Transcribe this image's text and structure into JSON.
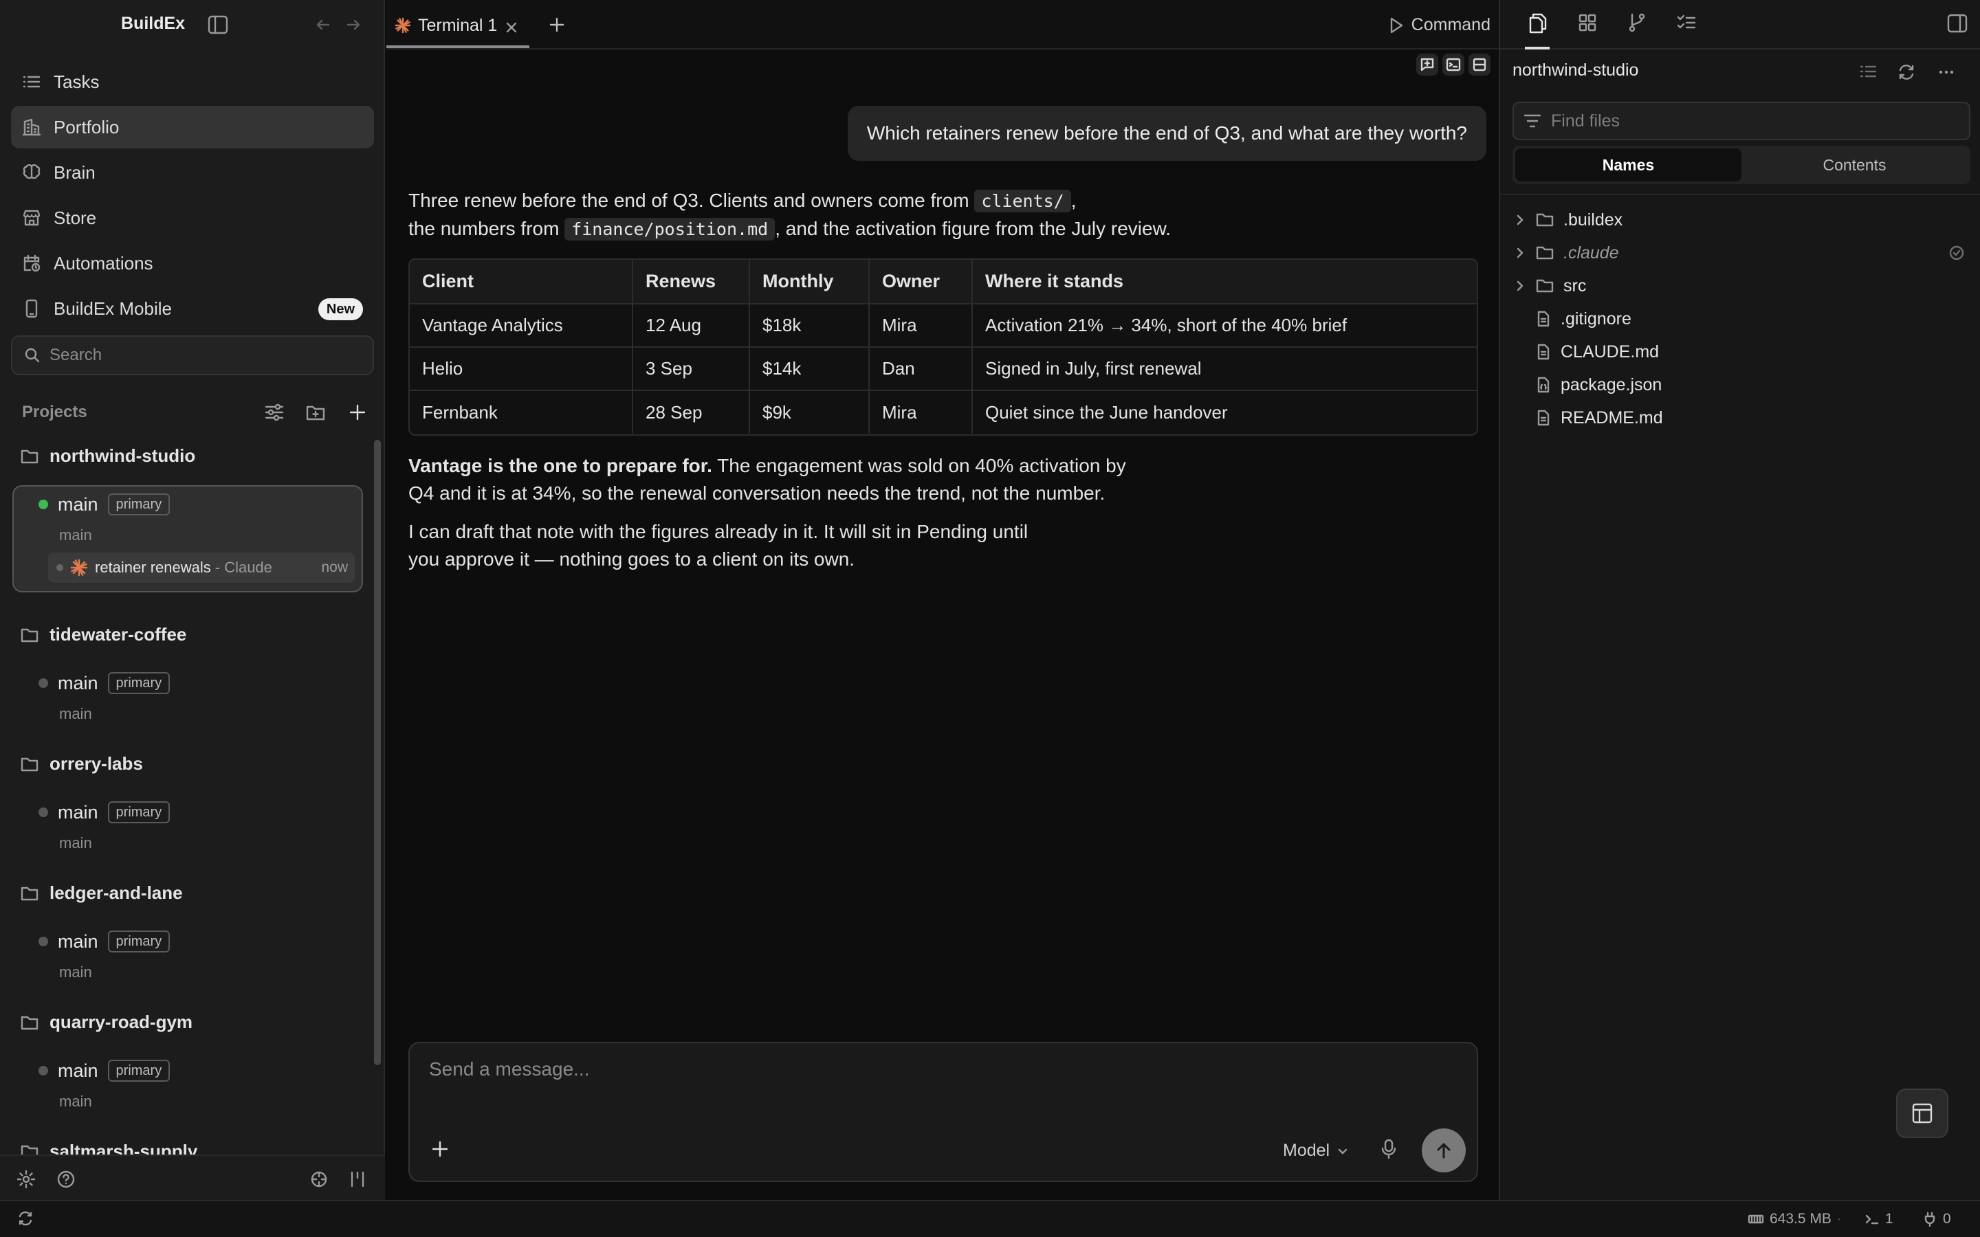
{
  "app": {
    "name": "BuildEx"
  },
  "sidebar": {
    "nav": [
      {
        "label": "Tasks",
        "icon": "list-icon"
      },
      {
        "label": "Portfolio",
        "icon": "building-icon",
        "active": true
      },
      {
        "label": "Brain",
        "icon": "brain-icon"
      },
      {
        "label": "Store",
        "icon": "store-icon"
      },
      {
        "label": "Automations",
        "icon": "calendar-clock-icon"
      },
      {
        "label": "BuildEx Mobile",
        "icon": "phone-icon",
        "badge": "New"
      }
    ],
    "search_placeholder": "Search",
    "projects_label": "Projects",
    "projects": [
      {
        "name": "northwind-studio",
        "branch": "main",
        "tag": "primary",
        "sub": "main",
        "active": true,
        "session": {
          "name": "retainer renewals",
          "agent": "- Claude",
          "time": "now"
        }
      },
      {
        "name": "tidewater-coffee",
        "branch": "main",
        "tag": "primary",
        "sub": "main"
      },
      {
        "name": "orrery-labs",
        "branch": "main",
        "tag": "primary",
        "sub": "main"
      },
      {
        "name": "ledger-and-lane",
        "branch": "main",
        "tag": "primary",
        "sub": "main"
      },
      {
        "name": "quarry-road-gym",
        "branch": "main",
        "tag": "primary",
        "sub": "main"
      },
      {
        "name": "saltmarsh-supply"
      }
    ]
  },
  "terminal": {
    "tab_label": "Terminal 1",
    "command_label": "Command",
    "user_message": "Which retainers renew before the end of Q3, and what are they worth?",
    "reply": {
      "intro_a": "Three renew before the end of Q3. Clients and owners come from ",
      "code1": "clients/",
      "intro_b": ",",
      "intro_c": "the numbers from ",
      "code2": "finance/position.md",
      "intro_d": ", and the activation figure from the July review.",
      "table": {
        "headers": [
          "Client",
          "Renews",
          "Monthly",
          "Owner",
          "Where it stands"
        ],
        "rows": [
          [
            "Vantage Analytics",
            "12 Aug",
            "$18k",
            "Mira",
            "Activation 21% → 34%, short of the 40% brief"
          ],
          [
            "Helio",
            "3 Sep",
            "$14k",
            "Dan",
            "Signed in July, first renewal"
          ],
          [
            "Fernbank",
            "28 Sep",
            "$9k",
            "Mira",
            "Quiet since the June handover"
          ]
        ]
      },
      "p2_bold": "Vantage is the one to prepare for.",
      "p2_a": " The engagement was sold on 40% activation by",
      "p2_b": "Q4 and it is at 34%, so the renewal conversation needs the trend, not the number.",
      "p3_a": "I can draft that note with the figures already in it. It will sit in Pending until",
      "p3_b": "you approve it — nothing goes to a client on its own."
    },
    "composer": {
      "placeholder": "Send a message...",
      "model_label": "Model"
    }
  },
  "files": {
    "project": "northwind-studio",
    "find_placeholder": "Find files",
    "seg": [
      "Names",
      "Contents"
    ],
    "tree": [
      {
        "name": ".buildex",
        "type": "folder"
      },
      {
        "name": ".claude",
        "type": "folder",
        "ignored": true
      },
      {
        "name": "src",
        "type": "folder"
      },
      {
        "name": ".gitignore",
        "type": "file"
      },
      {
        "name": "CLAUDE.md",
        "type": "file"
      },
      {
        "name": "package.json",
        "type": "file"
      },
      {
        "name": "README.md",
        "type": "file"
      }
    ]
  },
  "status": {
    "memory": "643.5 MB",
    "terminals": "1",
    "ports": "0"
  }
}
